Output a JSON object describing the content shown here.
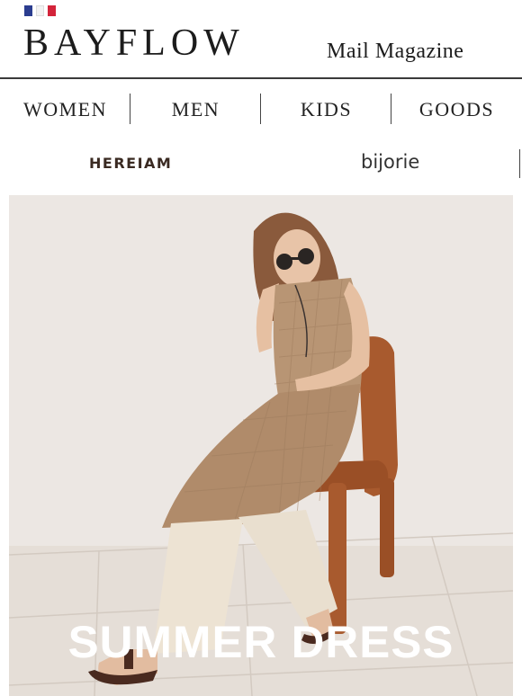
{
  "header": {
    "brand_name": "BAYFLOW",
    "subtitle": "Mail Magazine",
    "flag_colors": [
      "#2b3d8f",
      "#ffffff",
      "#d3243a"
    ]
  },
  "nav": {
    "items": [
      {
        "label": "WOMEN"
      },
      {
        "label": "MEN"
      },
      {
        "label": "KIDS"
      },
      {
        "label": "GOODS"
      }
    ]
  },
  "brands": {
    "items": [
      {
        "label": "HEREIAM"
      },
      {
        "label": "bijorie"
      }
    ]
  },
  "hero": {
    "title": "SUMMER DRESS",
    "image_icon": "model-in-sheer-summer-dress-photo"
  },
  "colors": {
    "divider": "#3a3a3a",
    "text": "#1c1c1c",
    "hero_wall": "#ebe6e2",
    "hero_floor": "#e4ddd6",
    "chair": "#a85a2e"
  }
}
